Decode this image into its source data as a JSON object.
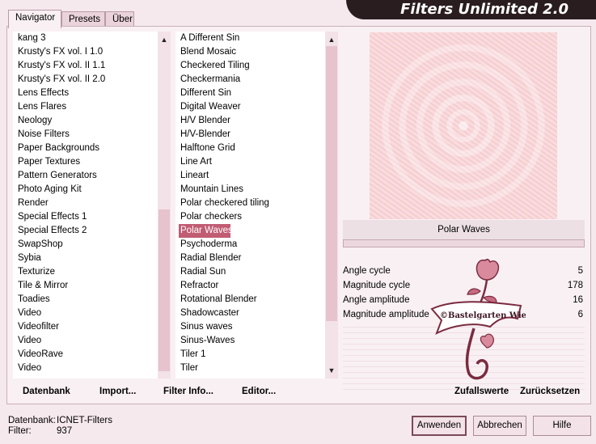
{
  "title": "Filters Unlimited 2.0",
  "tabs": [
    {
      "label": "Navigator"
    },
    {
      "label": "Presets"
    },
    {
      "label": "Über"
    }
  ],
  "categories": [
    "kang 3",
    "Krusty's FX vol. I 1.0",
    "Krusty's FX vol. II 1.1",
    "Krusty's FX vol. II 2.0",
    "Lens Effects",
    "Lens Flares",
    "Neology",
    "Noise Filters",
    "Paper Backgrounds",
    "Paper Textures",
    "Pattern Generators",
    "Photo Aging Kit",
    "Render",
    "Special Effects 1",
    "Special Effects 2",
    "SwapShop",
    "Sybia",
    "Texturize",
    "Tile & Mirror",
    "Toadies",
    "Video",
    "Videofilter",
    "Video",
    "VideoRave",
    "Video"
  ],
  "filters": [
    "A Different Sin",
    "Blend Mosaic",
    "Checkered Tiling",
    "Checkermania",
    "Different Sin",
    "Digital Weaver",
    "H/V Blender",
    "H/V-Blender",
    "Halftone Grid",
    "Line Art",
    "Lineart",
    "Mountain Lines",
    "Polar checkered tiling",
    "Polar checkers",
    "Polar Waves",
    "Psychoderma",
    "Radial Blender",
    "Radial Sun",
    "Refractor",
    "Rotational Blender",
    "Shadowcaster",
    "Sinus waves",
    "Sinus-Waves",
    "Tiler 1",
    "Tiler"
  ],
  "selected_filter_index": 14,
  "filter_name": "Polar Waves",
  "params": [
    {
      "label": "Angle cycle",
      "value": "5"
    },
    {
      "label": "Magnitude cycle",
      "value": "178"
    },
    {
      "label": "Angle amplitude",
      "value": "16"
    },
    {
      "label": "Magnitude amplitude",
      "value": "6"
    }
  ],
  "left_buttons": {
    "datenbank": "Datenbank",
    "import": "Import...",
    "filterinfo": "Filter Info...",
    "editor": "Editor..."
  },
  "right_buttons": {
    "random": "Zufallswerte",
    "reset": "Zurücksetzen"
  },
  "status": {
    "db_label": "Datenbank:",
    "db_value": "ICNET-Filters",
    "filter_label": "Filter:",
    "filter_value": "937"
  },
  "dialog_buttons": {
    "apply": "Anwenden",
    "cancel": "Abbrechen",
    "help": "Hilfe"
  },
  "watermark": "©Bastelgarten Wien",
  "colors": {
    "accent": "#c05c73",
    "title_bg": "#2a1d20",
    "background": "#f6e9ee"
  }
}
